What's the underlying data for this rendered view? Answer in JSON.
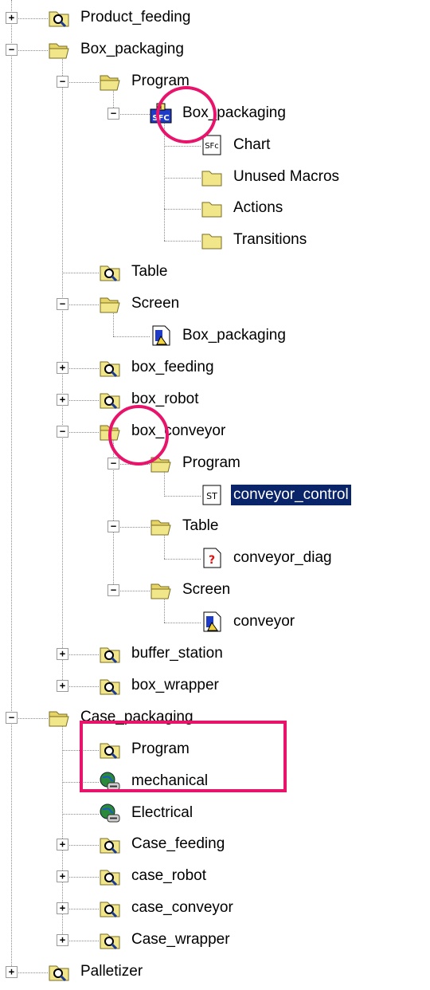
{
  "colors": {
    "annotation": "#e8136b",
    "selection": "#0a246a",
    "folder": "#f2e68b"
  },
  "tree": [
    {
      "label": "Product_feeding",
      "level": 0,
      "icon": "folder-magnifier-icon",
      "expander": "+"
    },
    {
      "label": "Box_packaging",
      "level": 0,
      "icon": "folder-open-icon",
      "expander": "−"
    },
    {
      "label": "Program",
      "level": 1,
      "icon": "folder-open-icon",
      "expander": "−"
    },
    {
      "label": "Box_packaging",
      "level": 2,
      "icon": "sfc-program-icon",
      "expander": "−"
    },
    {
      "label": "Chart",
      "level": 3,
      "icon": "sfc-chart-icon"
    },
    {
      "label": "Unused Macros",
      "level": 3,
      "icon": "folder-icon"
    },
    {
      "label": "Actions",
      "level": 3,
      "icon": "folder-icon"
    },
    {
      "label": "Transitions",
      "level": 3,
      "icon": "folder-icon"
    },
    {
      "label": "Table",
      "level": 1,
      "icon": "folder-magnifier-icon"
    },
    {
      "label": "Screen",
      "level": 1,
      "icon": "folder-open-icon",
      "expander": "−"
    },
    {
      "label": "Box_packaging",
      "level": 2,
      "icon": "screen-icon"
    },
    {
      "label": "box_feeding",
      "level": 1,
      "icon": "folder-magnifier-icon",
      "expander": "+"
    },
    {
      "label": "box_robot",
      "level": 1,
      "icon": "folder-magnifier-icon",
      "expander": "+"
    },
    {
      "label": "box_conveyor",
      "level": 1,
      "icon": "folder-open-icon",
      "expander": "−"
    },
    {
      "label": "Program",
      "level": 2,
      "icon": "folder-open-icon",
      "expander": "−"
    },
    {
      "label": "conveyor_control",
      "level": 3,
      "icon": "st-program-icon",
      "selected": true
    },
    {
      "label": "Table",
      "level": 2,
      "icon": "folder-open-icon",
      "expander": "−"
    },
    {
      "label": "conveyor_diag",
      "level": 3,
      "icon": "diagnostic-table-icon"
    },
    {
      "label": "Screen",
      "level": 2,
      "icon": "folder-open-icon",
      "expander": "−"
    },
    {
      "label": "conveyor",
      "level": 3,
      "icon": "screen-icon"
    },
    {
      "label": "buffer_station",
      "level": 1,
      "icon": "folder-magnifier-icon",
      "expander": "+"
    },
    {
      "label": "box_wrapper",
      "level": 1,
      "icon": "folder-magnifier-icon",
      "expander": "+"
    },
    {
      "label": "Case_packaging",
      "level": 0,
      "icon": "folder-open-icon",
      "expander": "−"
    },
    {
      "label": "Program",
      "level": 1,
      "icon": "folder-magnifier-icon"
    },
    {
      "label": "mechanical",
      "level": 1,
      "icon": "globe-link-icon"
    },
    {
      "label": "Electrical",
      "level": 1,
      "icon": "globe-link-icon"
    },
    {
      "label": "Case_feeding",
      "level": 1,
      "icon": "folder-magnifier-icon",
      "expander": "+"
    },
    {
      "label": "case_robot",
      "level": 1,
      "icon": "folder-magnifier-icon",
      "expander": "+"
    },
    {
      "label": "case_conveyor",
      "level": 1,
      "icon": "folder-magnifier-icon",
      "expander": "+"
    },
    {
      "label": "Case_wrapper",
      "level": 1,
      "icon": "folder-magnifier-icon",
      "expander": "+"
    },
    {
      "label": "Palletizer",
      "level": 0,
      "icon": "folder-magnifier-icon",
      "expander": "+"
    }
  ]
}
